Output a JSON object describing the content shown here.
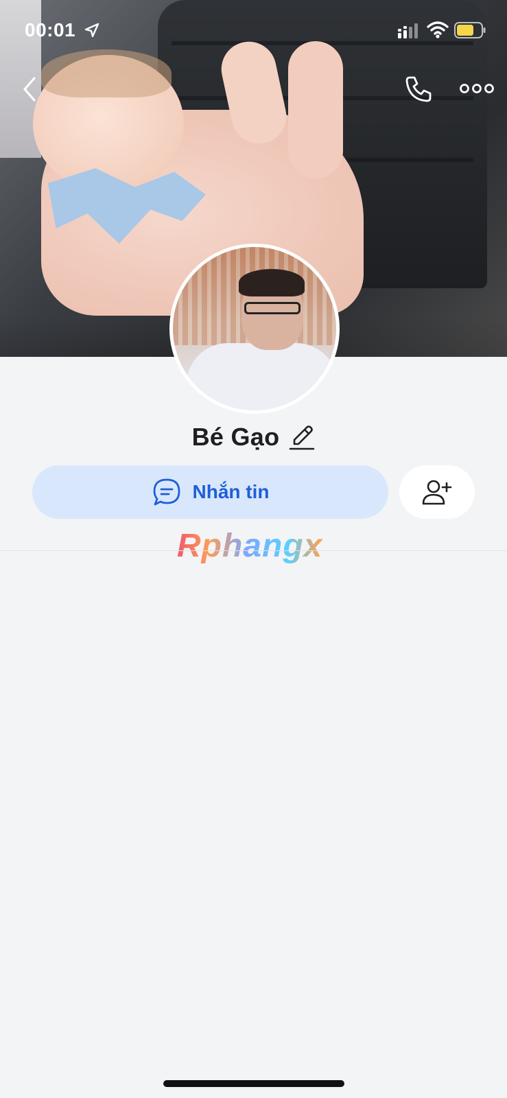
{
  "status_bar": {
    "time": "00:01",
    "icons": [
      "location-arrow-icon",
      "cellular-signal-icon",
      "wifi-icon",
      "battery-icon"
    ],
    "battery_color": "#f5d64a"
  },
  "nav": {
    "back_icon": "chevron-left-icon",
    "call_icon": "phone-icon",
    "more_icon": "more-dots-icon"
  },
  "profile": {
    "name": "Bé Gạo",
    "edit_icon": "pencil-icon"
  },
  "actions": {
    "message_label": "Nhắn tin",
    "message_icon": "chat-bubble-icon",
    "add_friend_icon": "add-user-icon"
  },
  "watermark": {
    "text": "Rphangx"
  },
  "colors": {
    "primary_blue": "#1e5fd8",
    "message_bg": "#d9e7fd",
    "page_bg": "#f3f4f6"
  }
}
